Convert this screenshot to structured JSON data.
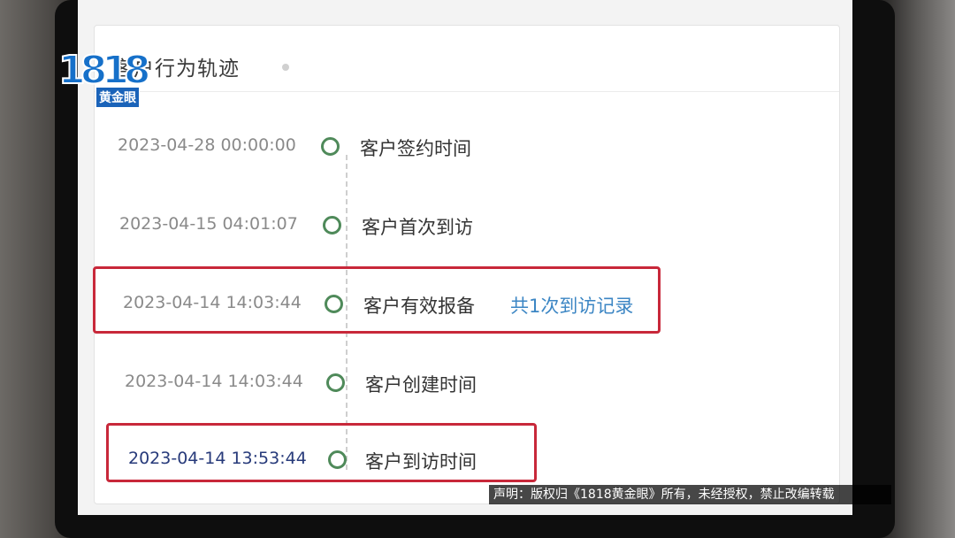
{
  "panel": {
    "title": "客户行为轨迹"
  },
  "timeline": [
    {
      "time": "2023-04-28 00:00:00",
      "event": "客户签约时间"
    },
    {
      "time": "2023-04-15 04:01:07",
      "event": "客户首次到访"
    },
    {
      "time": "2023-04-14 14:03:44",
      "event": "客户有效报备",
      "link": "共1次到访记录"
    },
    {
      "time": "2023-04-14 14:03:44",
      "event": "客户创建时间"
    },
    {
      "time": "2023-04-14 13:53:44",
      "event": "客户到访时间"
    }
  ],
  "watermark": {
    "logo_digits": "1818",
    "logo_text": "黄金眼"
  },
  "caption": {
    "text": "声明：版权归《1818黄金眼》所有，未经授权，禁止改编转载"
  },
  "colors": {
    "node": "#4f8a5a",
    "link": "#3c86c4",
    "highlight": "#c8283a"
  }
}
